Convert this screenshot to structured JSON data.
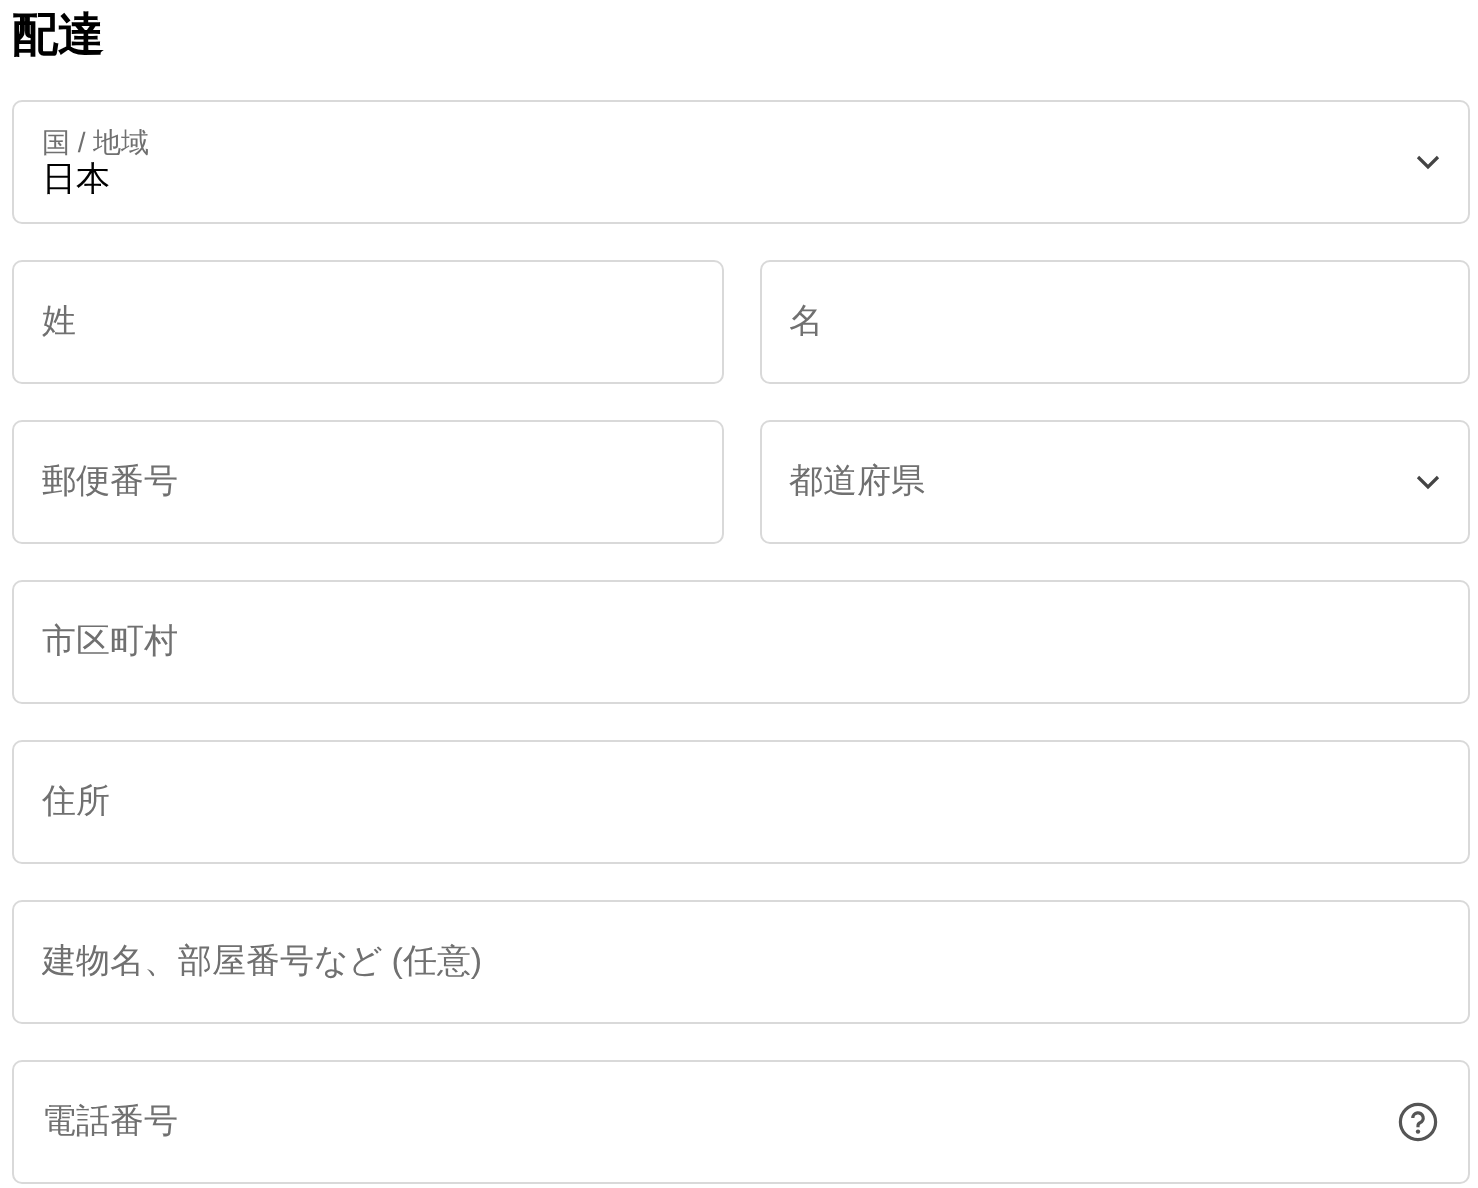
{
  "heading": "配達",
  "rows": [
    [
      {
        "kind": "select",
        "label": "国 / 地域",
        "value": "日本"
      }
    ],
    [
      {
        "kind": "text",
        "placeholder": "姓"
      },
      {
        "kind": "text",
        "placeholder": "名"
      }
    ],
    [
      {
        "kind": "text",
        "placeholder": "郵便番号"
      },
      {
        "kind": "select",
        "placeholder": "都道府県"
      }
    ],
    [
      {
        "kind": "text",
        "placeholder": "市区町村"
      }
    ],
    [
      {
        "kind": "text",
        "placeholder": "住所"
      }
    ],
    [
      {
        "kind": "text",
        "placeholder": "建物名、部屋番号など (任意)"
      }
    ],
    [
      {
        "kind": "help",
        "placeholder": "電話番号"
      }
    ]
  ]
}
